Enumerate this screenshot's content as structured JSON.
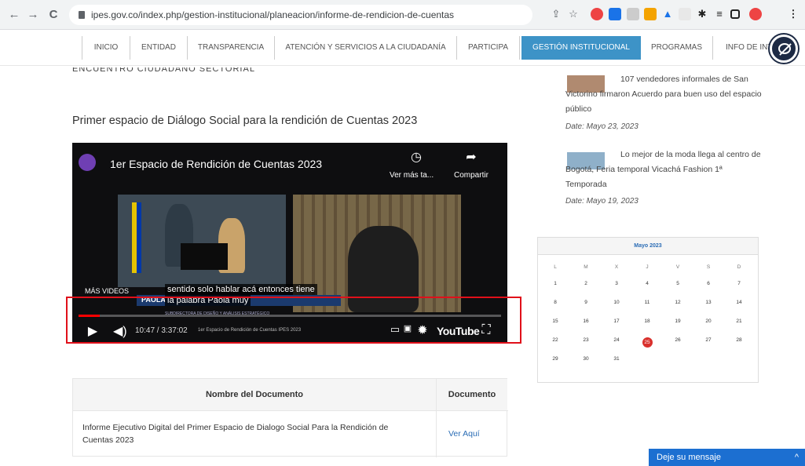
{
  "browser": {
    "url": "ipes.gov.co/index.php/gestion-institucional/planeacion/informe-de-rendicion-de-cuentas",
    "back_icon": "←",
    "forward_icon": "→",
    "reload_icon": "C"
  },
  "nav": {
    "items": [
      "INICIO",
      "ENTIDAD",
      "TRANSPARENCIA",
      "ATENCIÓN Y SERVICIOS A LA CIUDADANÍA",
      "PARTICIPA",
      "GESTIÓN INSTITUCIONAL",
      "PROGRAMAS",
      "INFO DE INT"
    ],
    "active_index": 5,
    "active_color": "#3d93c7"
  },
  "main": {
    "clipped_text": "ENCUENTRO CIUDADANO SECTORIAL",
    "heading": "Primer espacio de Diálogo Social para la rendición de Cuentas 2023"
  },
  "video": {
    "title": "1er Espacio de Rendición de Cuentas 2023",
    "watch_later_label": "Ver más ta...",
    "share_label": "Compartir",
    "more_videos_label": "MÁS VIDEOS",
    "caption_line1": "sentido solo hablar acá entonces tiene",
    "caption_line2": "la palabra Paola muy",
    "time": "10:47 / 3:37:02",
    "chapter": "1er Espacio de Rendición de Cuentas IPES 2023",
    "lower_third_name": "PAOLA",
    "lower_third_role": "SUBDIRECTORA DE DISEÑO Y ANÁLISIS ESTRATÉGICO",
    "youtube_label": "YouTube",
    "progress": 0.05
  },
  "documents": {
    "col_name": "Nombre del Documento",
    "col_doc": "Documento",
    "row_name": "Informe Ejecutivo Digital del Primer Espacio de Dialogo Social Para la Rendición de Cuentas 2023",
    "row_link": "Ver Aquí"
  },
  "sidebar": {
    "news": [
      {
        "title": "107 vendedores informales de San Victorino firmaron Acuerdo para buen uso del espacio público",
        "date": "Date: Mayo 23, 2023"
      },
      {
        "title": "Lo mejor de la moda llega al centro de Bogotá, Feria temporal Vicachá Fashion 1ª Temporada",
        "date": "Date: Mayo 19, 2023"
      }
    ],
    "calendar": {
      "month": "Mayo 2023",
      "days_of_week": [
        "L",
        "M",
        "X",
        "J",
        "V",
        "S",
        "D"
      ],
      "weeks": [
        [
          "1",
          "2",
          "3",
          "4",
          "5",
          "6",
          "7"
        ],
        [
          "8",
          "9",
          "10",
          "11",
          "12",
          "13",
          "14"
        ],
        [
          "15",
          "16",
          "17",
          "18",
          "19",
          "20",
          "21"
        ],
        [
          "22",
          "23",
          "24",
          "25",
          "26",
          "27",
          "28"
        ],
        [
          "29",
          "30",
          "31",
          "",
          "",
          "",
          ""
        ]
      ],
      "today": "25"
    }
  },
  "chat": {
    "label": "Deje su mensaje",
    "caret": "^"
  }
}
